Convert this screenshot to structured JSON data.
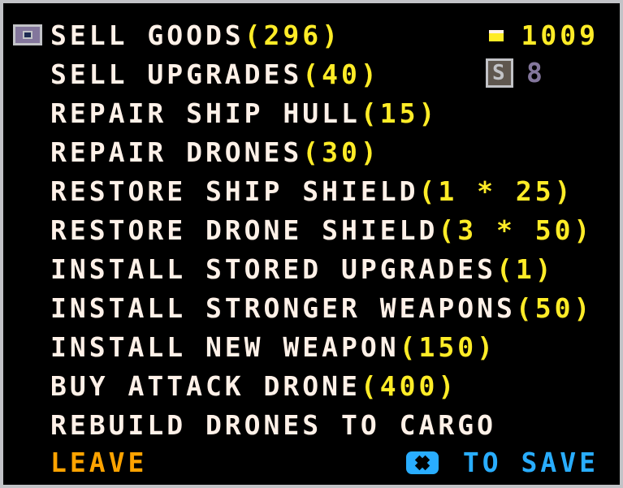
{
  "menu": {
    "items": [
      {
        "label": "SELL GOODS",
        "cost": "(296)"
      },
      {
        "label": "SELL UPGRADES",
        "cost": "(40)"
      },
      {
        "label": "REPAIR SHIP HULL",
        "cost": "(15)"
      },
      {
        "label": "REPAIR DRONES",
        "cost": "(30)"
      },
      {
        "label": "RESTORE SHIP SHIELD",
        "cost": "(1 * 25)"
      },
      {
        "label": "RESTORE DRONE SHIELD",
        "cost": "(3 * 50)"
      },
      {
        "label": "INSTALL STORED UPGRADES",
        "cost": "(1)"
      },
      {
        "label": "INSTALL STRONGER WEAPONS",
        "cost": "(50)"
      },
      {
        "label": "INSTALL NEW WEAPON",
        "cost": "(150)"
      },
      {
        "label": "BUY ATTACK DRONE",
        "cost": "(400)"
      },
      {
        "label": "REBUILD DRONES TO CARGO",
        "cost": ""
      }
    ],
    "selected_index": 0
  },
  "status": {
    "money": "1009",
    "upgrades": "8"
  },
  "footer": {
    "leave_label": "LEAVE",
    "save_label": "TO SAVE"
  },
  "icons": {
    "selector": "cursor-icon",
    "money": "coin-icon",
    "upgrades": "upgrade-chip-icon",
    "save": "x-button-icon"
  },
  "colors": {
    "background": "#000000",
    "frame": "#c2c3c7",
    "text": "#fff1e8",
    "cost": "#ffec27",
    "leave": "#ffa300",
    "save": "#29adff",
    "upgrade_count": "#83769c"
  }
}
